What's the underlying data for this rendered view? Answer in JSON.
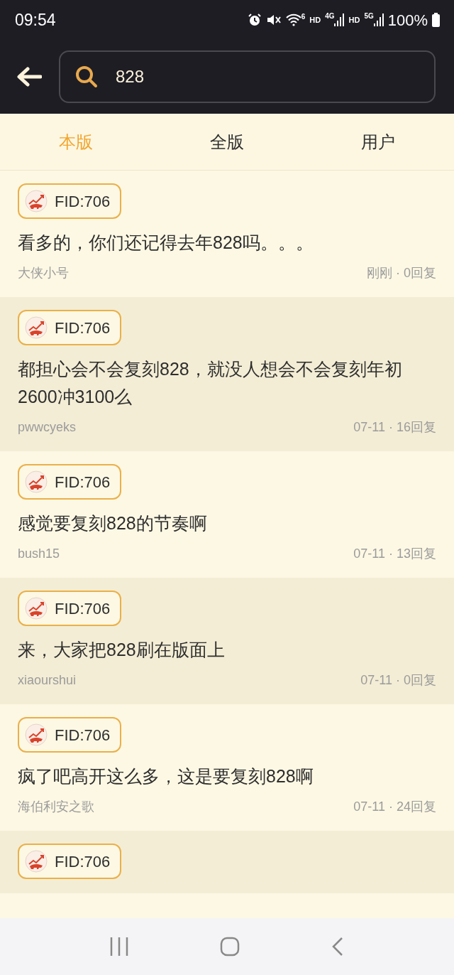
{
  "status_bar": {
    "time": "09:54",
    "wifi_label": "6",
    "network_1": {
      "hd": "HD",
      "gen": "4G"
    },
    "network_2": {
      "hd": "HD",
      "gen": "5G"
    },
    "battery": "100%"
  },
  "search": {
    "value": "828"
  },
  "tabs": [
    {
      "label": "本版",
      "selected": true
    },
    {
      "label": "全版",
      "selected": false
    },
    {
      "label": "用户",
      "selected": false
    }
  ],
  "posts": [
    {
      "forum": "FID:706",
      "title": "看多的，你们还记得去年828吗。。。",
      "author": "大侠小号",
      "meta": "刚刚 · 0回复"
    },
    {
      "forum": "FID:706",
      "title": "都担心会不会复刻828，就没人想会不会复刻年初2600冲3100么",
      "author": "pwwcyeks",
      "meta": "07-11 · 16回复"
    },
    {
      "forum": "FID:706",
      "title": "感觉要复刻828的节奏啊",
      "author": "bush15",
      "meta": "07-11 · 13回复"
    },
    {
      "forum": "FID:706",
      "title": "来，大家把828刷在版面上",
      "author": "xiaourshui",
      "meta": "07-11 · 0回复"
    },
    {
      "forum": "FID:706",
      "title": "疯了吧高开这么多，这是要复刻828啊",
      "author": "海伯利安之歌",
      "meta": "07-11 · 24回复"
    },
    {
      "forum": "FID:706"
    }
  ]
}
